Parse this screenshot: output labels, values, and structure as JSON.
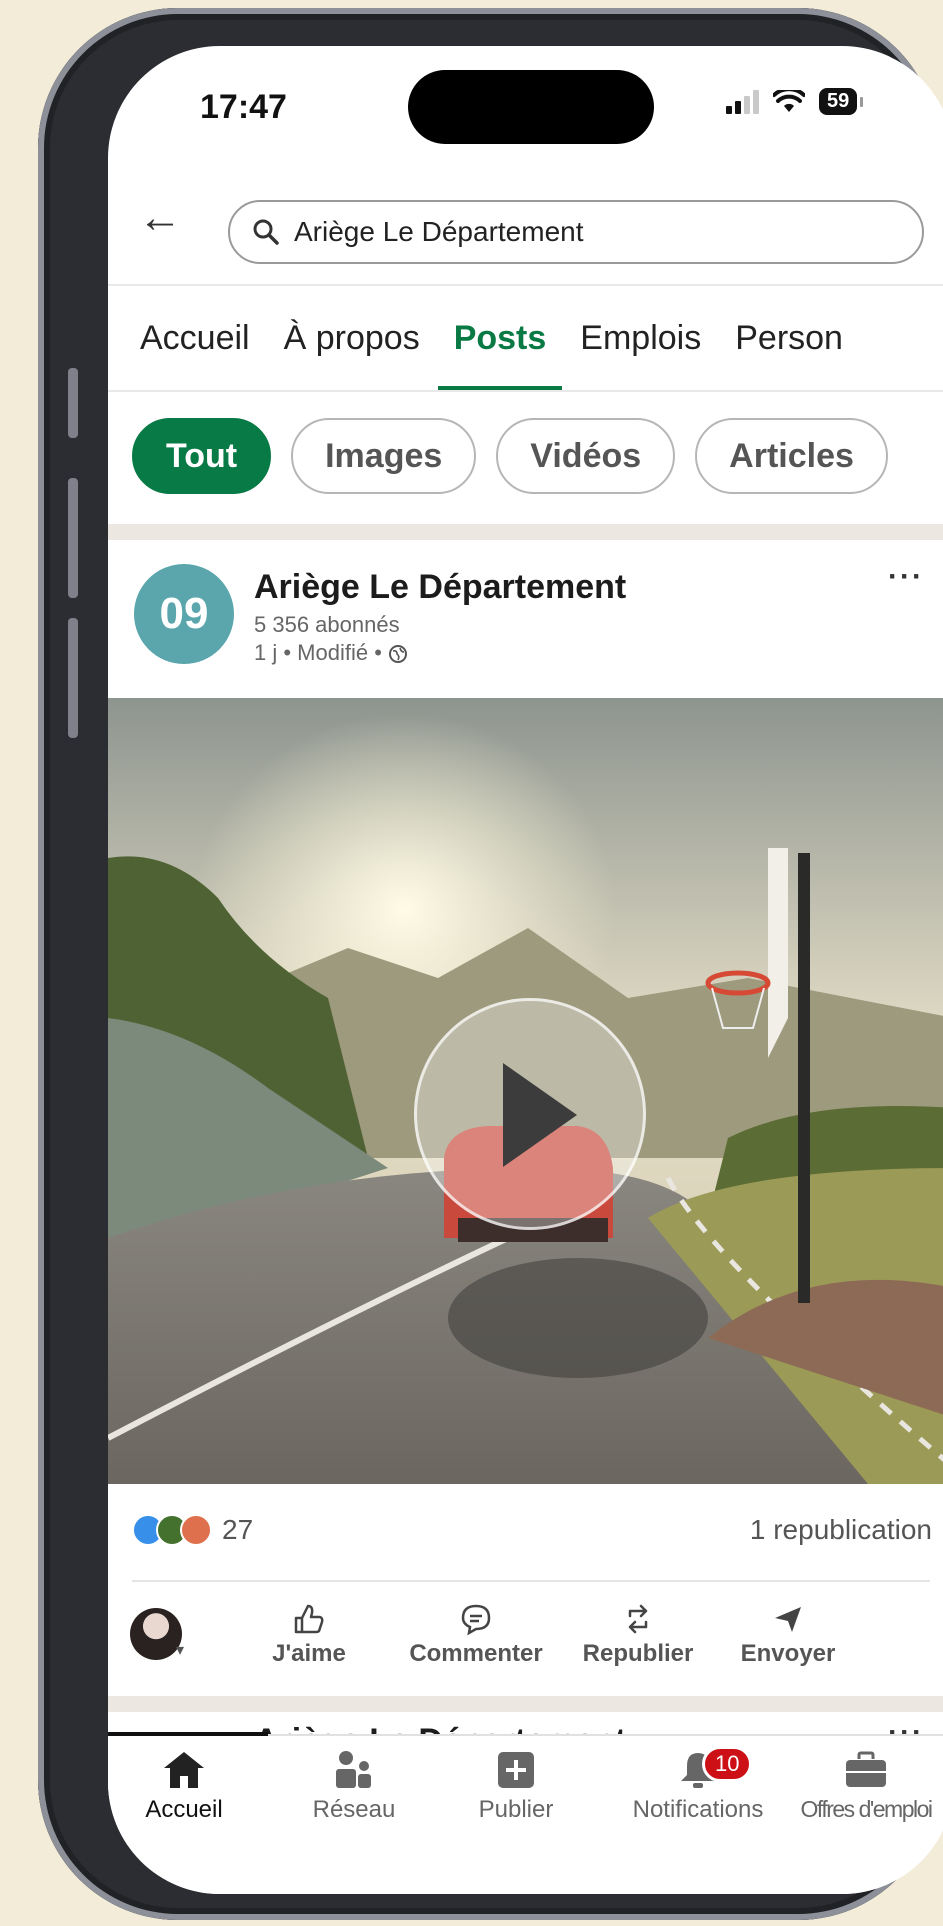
{
  "status_bar": {
    "time": "17:47",
    "battery": "59"
  },
  "search": {
    "query": "Ariège Le Département"
  },
  "tabs": [
    {
      "label": "Accueil"
    },
    {
      "label": "À propos"
    },
    {
      "label": "Posts"
    },
    {
      "label": "Emplois"
    },
    {
      "label": "Person"
    }
  ],
  "filters": [
    {
      "label": "Tout"
    },
    {
      "label": "Images"
    },
    {
      "label": "Vidéos"
    },
    {
      "label": "Articles"
    }
  ],
  "post": {
    "logo_text": "09",
    "author": "Ariège Le Département",
    "followers": "5 356 abonnés",
    "meta": "1 j • Modifié • ",
    "more": "···",
    "reactions_count": "27",
    "reposts": "1 republication",
    "reaction_colors": [
      "#378fe9",
      "#44712e",
      "#df704d"
    ],
    "actions": [
      {
        "label": "J'aime",
        "icon": "thumbs-up-icon"
      },
      {
        "label": "Commenter",
        "icon": "comment-icon"
      },
      {
        "label": "Republier",
        "icon": "repost-icon"
      },
      {
        "label": "Envoyer",
        "icon": "send-icon"
      }
    ]
  },
  "next_post": {
    "author": "Ariège Le Département",
    "more": "···"
  },
  "bottom_nav": [
    {
      "label": "Accueil",
      "icon": "home-icon",
      "active": true
    },
    {
      "label": "Réseau",
      "icon": "network-icon"
    },
    {
      "label": "Publier",
      "icon": "publish-icon"
    },
    {
      "label": "Notifications",
      "icon": "bell-icon",
      "badge": "10"
    },
    {
      "label": "Offres d'emploi",
      "icon": "briefcase-icon"
    }
  ],
  "colors": {
    "accent": "#0a7a44",
    "badge": "#cc1016",
    "side_tab": "#ef4256"
  }
}
